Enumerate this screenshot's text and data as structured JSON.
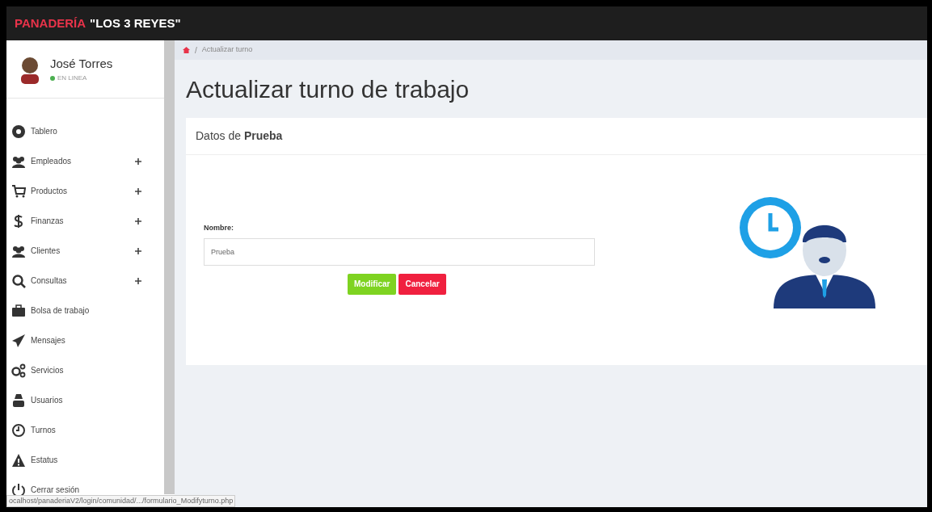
{
  "brand": {
    "name": "PANADERÍA",
    "subtitle": "\"LOS 3 REYES\""
  },
  "user": {
    "name": "José Torres",
    "status": "EN LINEA"
  },
  "sidebar": {
    "items": [
      {
        "label": "Tablero",
        "expandable": false
      },
      {
        "label": "Empleados",
        "expandable": true
      },
      {
        "label": "Productos",
        "expandable": true
      },
      {
        "label": "Finanzas",
        "expandable": true
      },
      {
        "label": "Clientes",
        "expandable": true
      },
      {
        "label": "Consultas",
        "expandable": true
      },
      {
        "label": "Bolsa de trabajo",
        "expandable": false
      },
      {
        "label": "Mensajes",
        "expandable": false
      },
      {
        "label": "Servicios",
        "expandable": false
      },
      {
        "label": "Usuarios",
        "expandable": false
      },
      {
        "label": "Turnos",
        "expandable": false
      },
      {
        "label": "Estatus",
        "expandable": false
      },
      {
        "label": "Cerrar sesión",
        "expandable": false
      }
    ]
  },
  "breadcrumb": {
    "separator": "/",
    "current": "Actualizar turno"
  },
  "page_title": "Actualizar turno de trabajo",
  "card": {
    "title": "Datos de **Prueba**",
    "field": {
      "label": "Nombre:",
      "value": "Prueba"
    },
    "buttons": [
      {
        "kind": "primary",
        "label": "Modificar"
      },
      {
        "kind": "danger",
        "label": "Cancelar"
      }
    ]
  },
  "status_bar": {
    "url": "ocalhost/panaderiaV2/login/comunidad/.../formulario_Modifyturno.php"
  }
}
